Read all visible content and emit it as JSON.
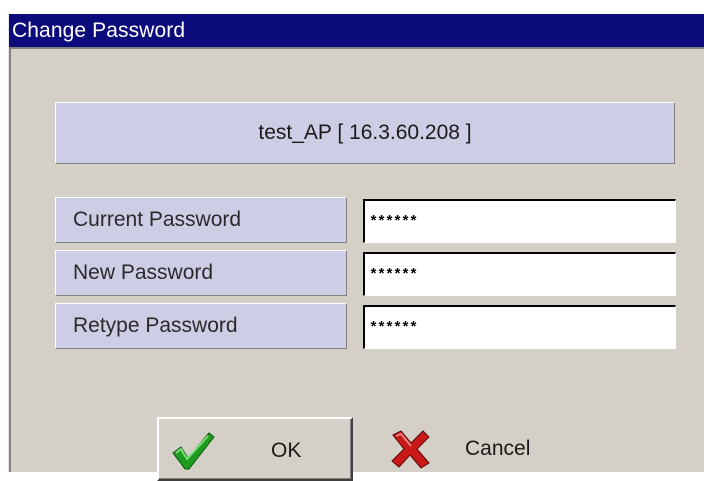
{
  "window": {
    "title": "Change Password"
  },
  "access_point": {
    "label": "test_AP [ 16.3.60.208 ]"
  },
  "fields": [
    {
      "label": "Current Password",
      "value": "******"
    },
    {
      "label": "New Password",
      "value": "******"
    },
    {
      "label": "Retype Password",
      "value": "******"
    }
  ],
  "buttons": {
    "ok_label": "OK",
    "ok_icon": "checkmark-icon",
    "cancel_label": "Cancel",
    "cancel_icon": "x-mark-icon"
  },
  "colors": {
    "titlebar": "#0b0b7c",
    "panel": "#cdcde6",
    "window_bg": "#d4d0c8",
    "check_green": "#1e9a1e",
    "cancel_red": "#c81818"
  }
}
